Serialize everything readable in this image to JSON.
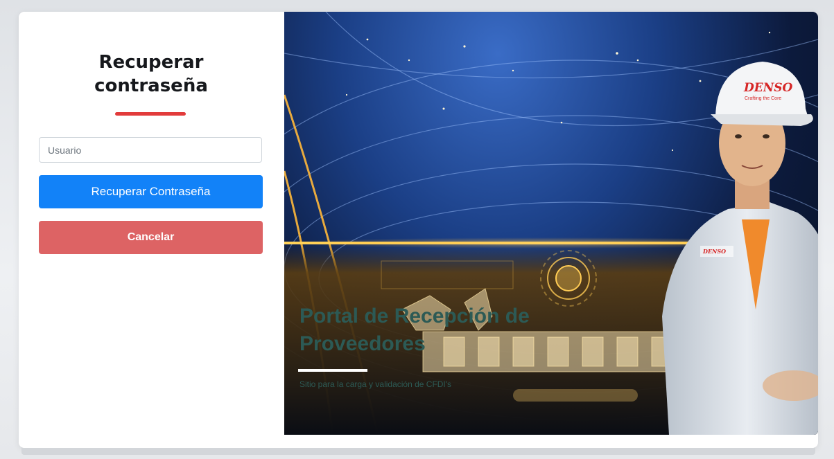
{
  "recovery": {
    "title_line1": "Recuperar",
    "title_line2": "contraseña",
    "username_placeholder": "Usuario",
    "recover_button_label": "Recuperar Contraseña",
    "cancel_button_label": "Cancelar"
  },
  "hero": {
    "title": "Portal de Recepción de Proveedores",
    "subtitle": "Sitio para la carga y validación de CFDI's",
    "logo_text": "DENSO",
    "logo_tagline": "Crafting the Core"
  },
  "colors": {
    "primary": "#1282f8",
    "danger": "#dd6364",
    "accent_underline": "#e23b3b",
    "hero_glow": "#ffc233"
  }
}
